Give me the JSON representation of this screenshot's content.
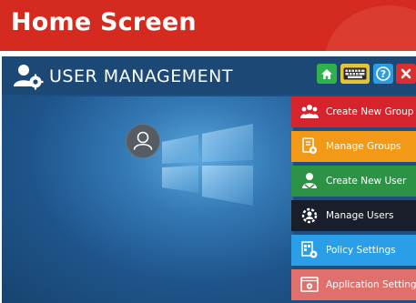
{
  "banner": {
    "title": "Home Screen"
  },
  "app": {
    "title": "USER MANAGEMENT",
    "toolbar": {
      "icons": [
        "home-icon",
        "keyboard-icon",
        "help-icon",
        "close-icon"
      ],
      "help_glyph": "?",
      "close_glyph": "✕"
    }
  },
  "menu": {
    "items": [
      {
        "label": "Create New Group",
        "icon": "create-group-icon",
        "color": "#d6232c"
      },
      {
        "label": "Manage Groups",
        "icon": "manage-groups-icon",
        "color": "#f29a18"
      },
      {
        "label": "Create New User",
        "icon": "create-user-icon",
        "color": "#2c9246"
      },
      {
        "label": "Manage Users",
        "icon": "manage-users-icon",
        "color": "#1a1d2a"
      },
      {
        "label": "Policy Settings",
        "icon": "policy-icon",
        "color": "#2a9ee6"
      },
      {
        "label": "Application Settings",
        "icon": "app-settings-icon",
        "color": "#e0706e"
      }
    ]
  },
  "colors": {
    "banner": "#d42a1f",
    "titlebar": "#1c4876"
  }
}
